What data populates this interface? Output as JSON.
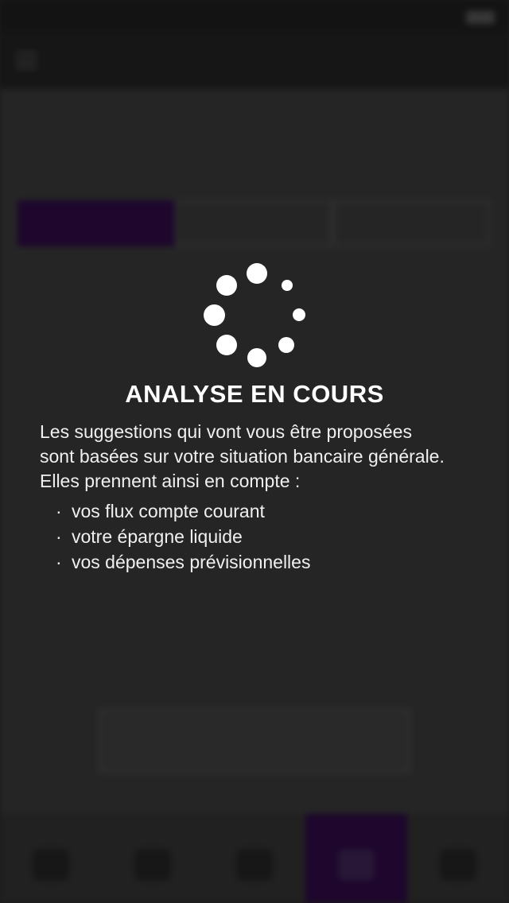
{
  "overlay": {
    "title": "ANALYSE EN COURS",
    "text_lines": [
      "Les suggestions qui vont vous être proposées",
      "sont basées sur votre situation bancaire générale.",
      "Elles prennent ainsi en compte :"
    ],
    "items": [
      "vos flux compte courant",
      "votre épargne liquide",
      "vos dépenses prévisionnelles"
    ],
    "spinner_icon": "loading-spinner-icon"
  },
  "colors": {
    "accent": "#2e0a44",
    "overlay_text": "#ffffff"
  }
}
